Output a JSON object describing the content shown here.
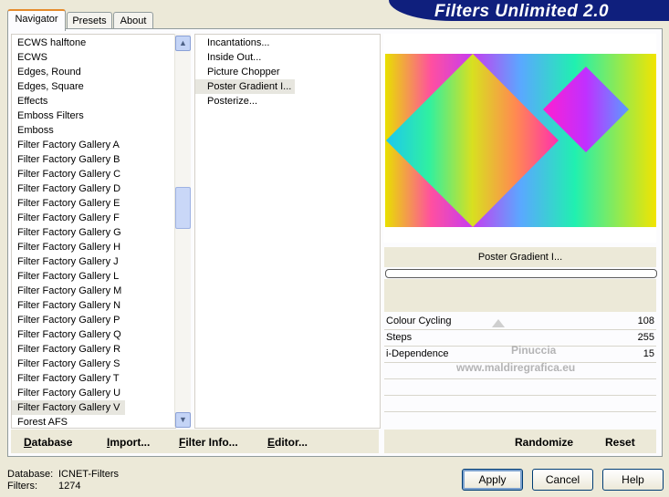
{
  "tabs": [
    "Navigator",
    "Presets",
    "About"
  ],
  "banner_title": "Filters Unlimited 2.0",
  "categories": [
    "ECWS halftone",
    "ECWS",
    "Edges, Round",
    "Edges, Square",
    "Effects",
    "Emboss Filters",
    "Emboss",
    "Filter Factory Gallery A",
    "Filter Factory Gallery B",
    "Filter Factory Gallery C",
    "Filter Factory Gallery D",
    "Filter Factory Gallery E",
    "Filter Factory Gallery F",
    "Filter Factory Gallery G",
    "Filter Factory Gallery H",
    "Filter Factory Gallery J",
    "Filter Factory Gallery L",
    "Filter Factory Gallery M",
    "Filter Factory Gallery N",
    "Filter Factory Gallery P",
    "Filter Factory Gallery Q",
    "Filter Factory Gallery R",
    "Filter Factory Gallery S",
    "Filter Factory Gallery T",
    "Filter Factory Gallery U",
    "Filter Factory Gallery V",
    "Forest AFS"
  ],
  "selected_category": "Filter Factory Gallery V",
  "filters": [
    "Incantations...",
    "Inside Out...",
    "Picture Chopper",
    "Poster Gradient I...",
    "Posterize..."
  ],
  "selected_filter": "Poster Gradient I...",
  "bottom_buttons": {
    "database": {
      "first": "D",
      "rest": "atabase"
    },
    "import": {
      "first": "I",
      "rest": "mport..."
    },
    "filter_info": {
      "first": "F",
      "rest": "ilter Info..."
    },
    "editor": {
      "first": "E",
      "rest": "ditor..."
    },
    "randomize": "Randomize",
    "reset": "Reset"
  },
  "filter_name_display": "Poster Gradient I...",
  "params": [
    {
      "label": "Colour Cycling",
      "value": "108"
    },
    {
      "label": "Steps",
      "value": "255"
    },
    {
      "label": "i-Dependence",
      "value": "15"
    }
  ],
  "watermark": {
    "line1": "Pinuccia",
    "line2": "www.maldiregrafica.eu"
  },
  "status": {
    "database_label": "Database:",
    "database_value": "ICNET-Filters",
    "filters_label": "Filters:",
    "filters_value": "1274"
  },
  "dialog_buttons": {
    "apply": "Apply",
    "cancel": "Cancel",
    "help": "Help"
  }
}
